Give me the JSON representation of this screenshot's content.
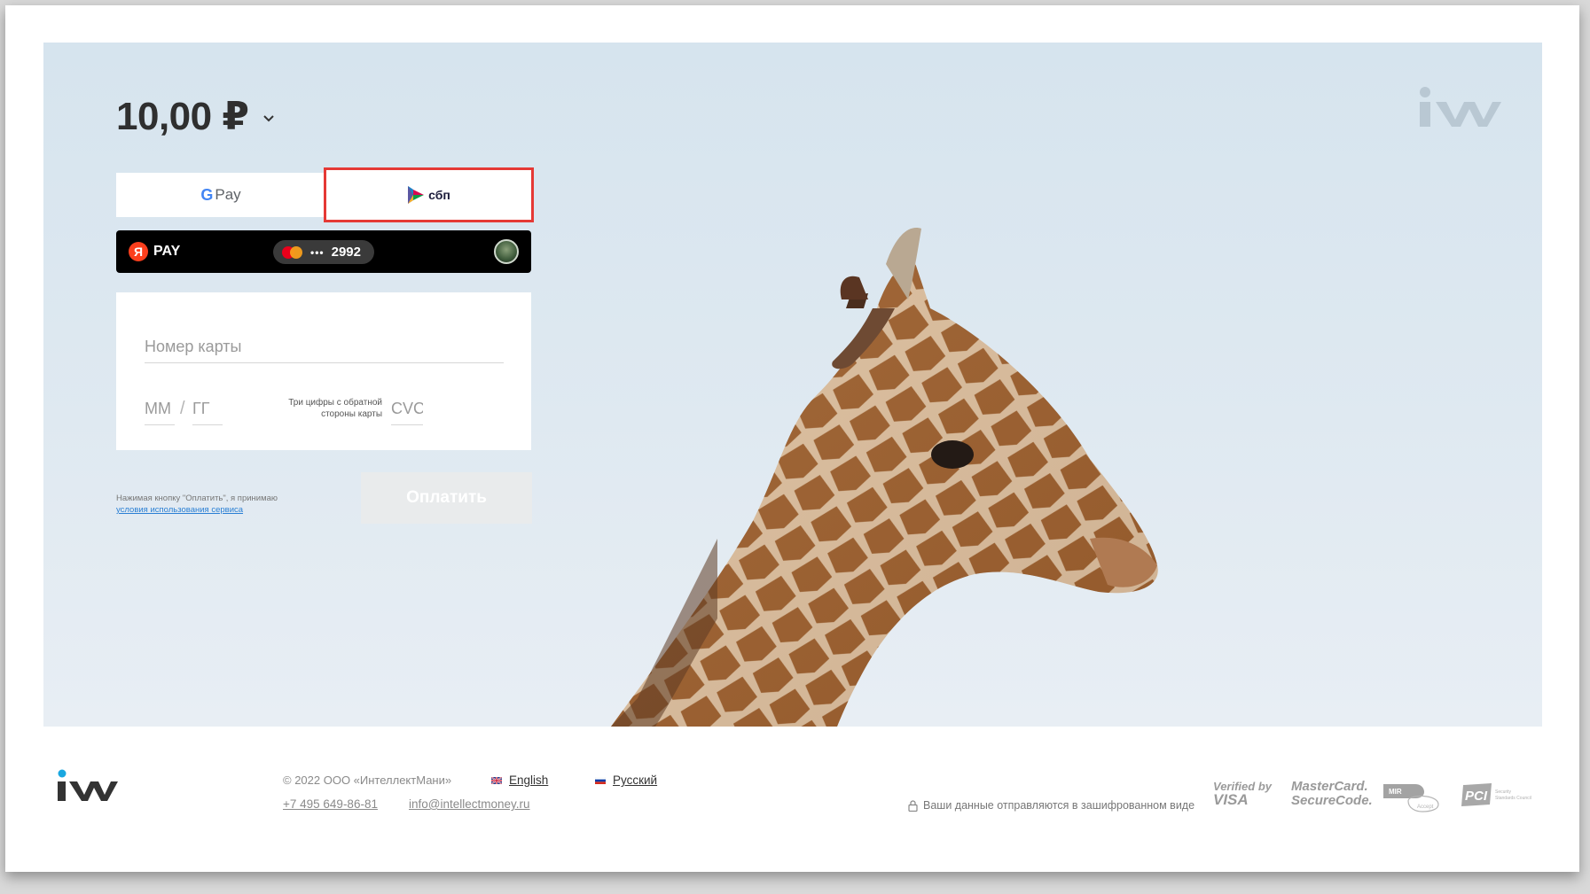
{
  "payment": {
    "amount": "10,00 ₽"
  },
  "methods": {
    "gpay_g": "G",
    "gpay_label": "Pay",
    "sbp_label": "сбп",
    "yandex_letter": "Я",
    "yandex_label": "PAY",
    "card_dots": "•••",
    "card_last4": "2992"
  },
  "card_form": {
    "number_placeholder": "Номер карты",
    "month_placeholder": "ММ",
    "year_placeholder": "ГГ",
    "slash": "/",
    "cvc_hint": "Три цифры с обратной стороны карты",
    "cvc_placeholder": "CVC"
  },
  "terms": {
    "text": "Нажимая кнопку \"Оплатить\", я принимаю",
    "link": "условия использования сервиса"
  },
  "submit_label": "Оплатить",
  "footer": {
    "copyright": "© 2022 ООО «ИнтеллектМани»",
    "lang_en": "English",
    "lang_ru": "Русский",
    "phone": "+7 495 649-86-81",
    "email": "info@intellectmoney.ru",
    "secure_note": "Ваши данные отправляются в зашифрованном виде",
    "badge_visa_small": "Verified by",
    "badge_visa_big": "VISA",
    "badge_mc_1": "MasterCard.",
    "badge_mc_2": "SecureCode.",
    "badge_mir_1": "MIR",
    "badge_mir_2": "Accept",
    "badge_pci_1": "PCI",
    "badge_pci_2": "Security",
    "badge_pci_3": "Standards Council"
  },
  "colors": {
    "highlight": "#e53935",
    "link": "#2a7fd4",
    "brand": "#9fb3c2",
    "yandex_red": "#fc3f1d"
  }
}
